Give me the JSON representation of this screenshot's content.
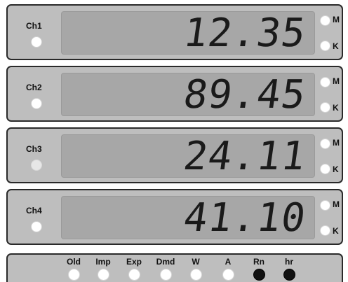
{
  "channels": [
    {
      "label": "Ch1",
      "value": "12.35"
    },
    {
      "label": "Ch2",
      "value": "89.45"
    },
    {
      "label": "Ch3",
      "value": "24.11"
    },
    {
      "label": "Ch4",
      "value": "41.10"
    }
  ],
  "units": {
    "mega": "M",
    "kilo": "K"
  },
  "indicators": [
    {
      "label": "Old",
      "state": "off"
    },
    {
      "label": "Imp",
      "state": "off"
    },
    {
      "label": "Exp",
      "state": "off"
    },
    {
      "label": "Dmd",
      "state": "off"
    },
    {
      "label": "W",
      "state": "off"
    },
    {
      "label": "A",
      "state": "off"
    },
    {
      "label": "Rn",
      "state": "on"
    },
    {
      "label": "hr",
      "state": "on"
    }
  ],
  "colors": {
    "panel": "#bebebe",
    "screen": "#a7a7a7",
    "digit": "#1a1a1a",
    "led_off": "#ffffff",
    "led_on": "#111111"
  }
}
